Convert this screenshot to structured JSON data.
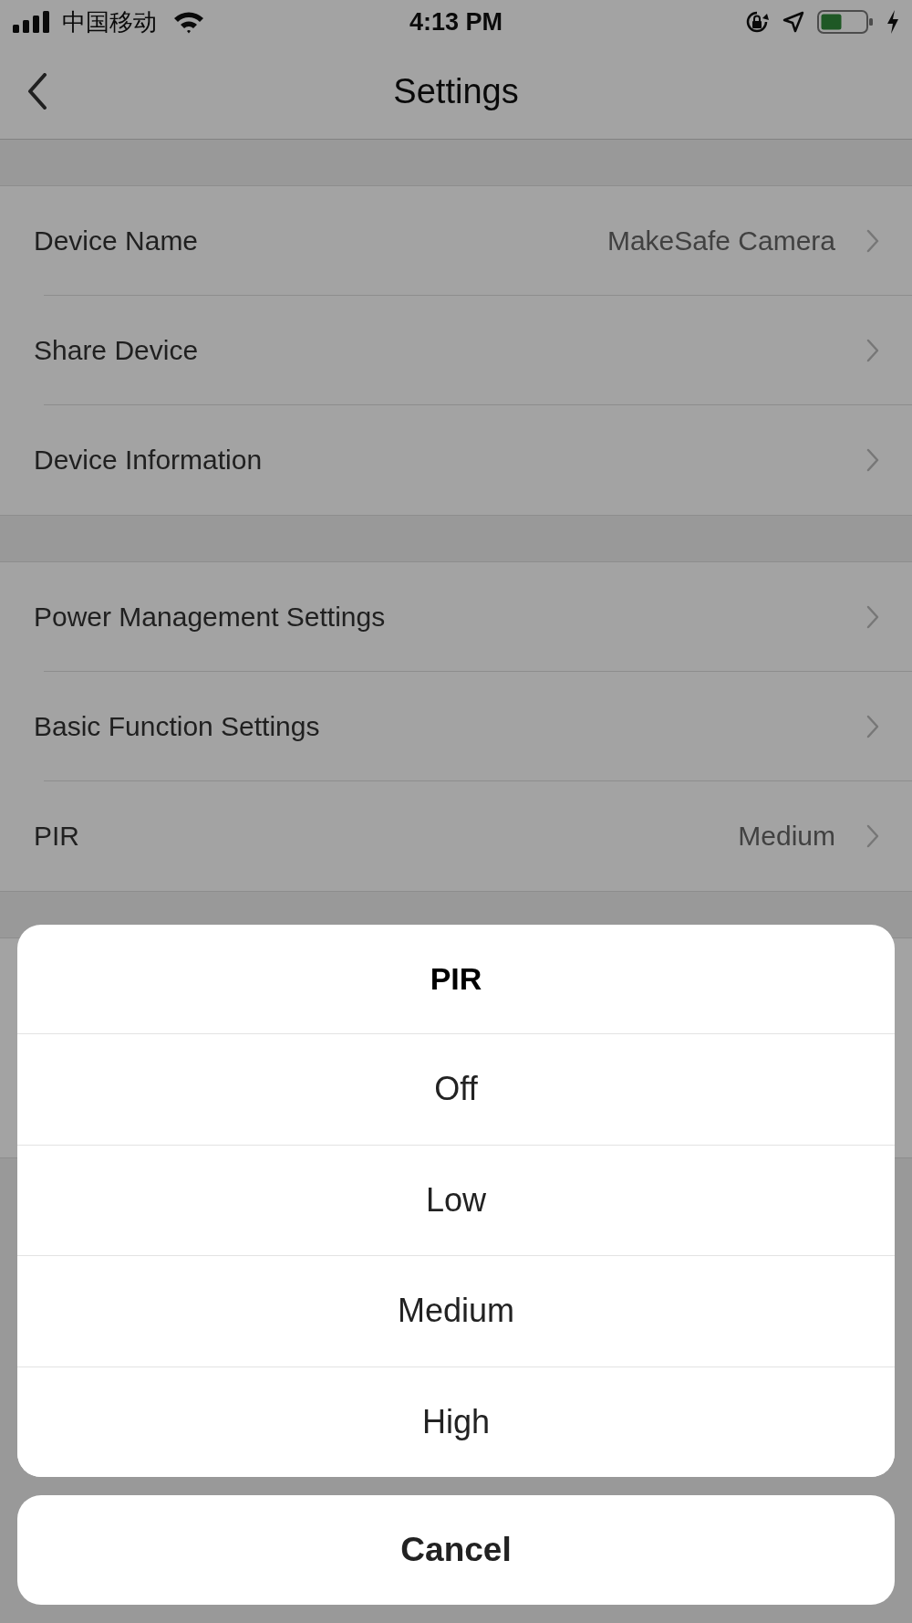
{
  "status_bar": {
    "carrier": "中国移动",
    "time": "4:13 PM"
  },
  "nav": {
    "title": "Settings"
  },
  "groups": [
    [
      {
        "label": "Device Name",
        "value": "MakeSafe Camera"
      },
      {
        "label": "Share Device"
      },
      {
        "label": "Device Information"
      }
    ],
    [
      {
        "label": "Power Management Settings"
      },
      {
        "label": "Basic Function Settings"
      },
      {
        "label": "PIR",
        "value": "Medium"
      }
    ]
  ],
  "action_sheet": {
    "title": "PIR",
    "options": [
      "Off",
      "Low",
      "Medium",
      "High"
    ],
    "cancel": "Cancel"
  }
}
